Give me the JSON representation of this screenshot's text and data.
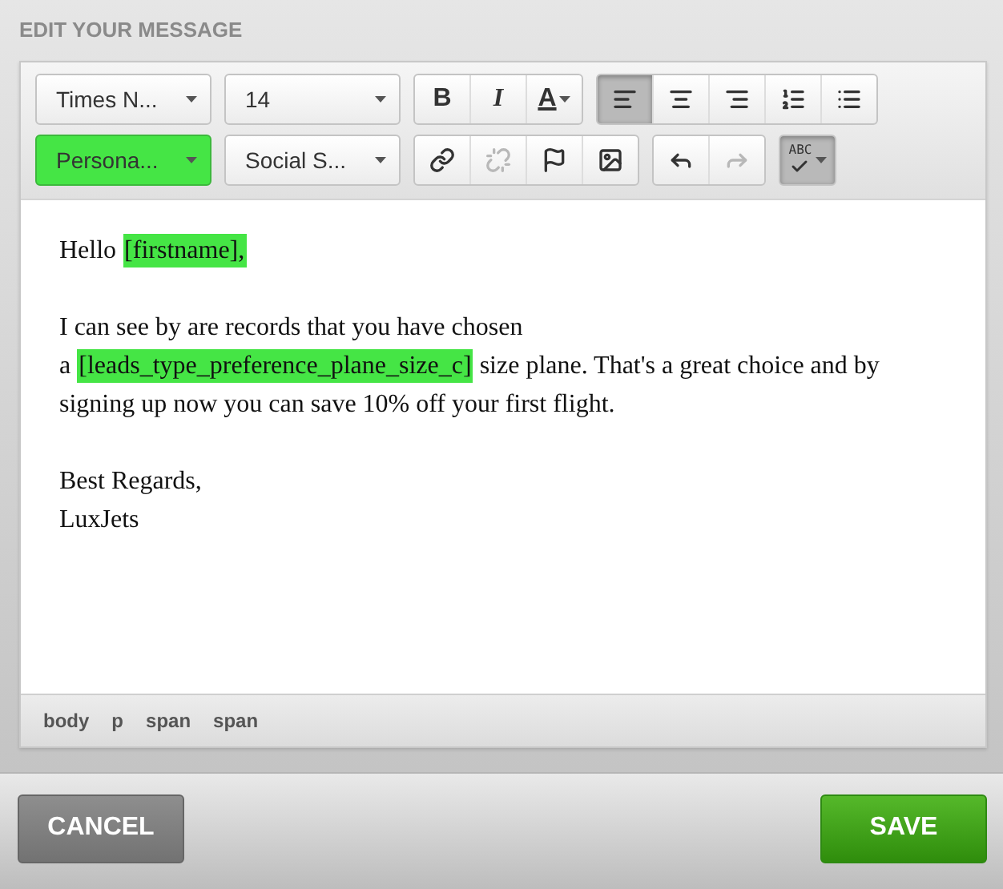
{
  "heading": "EDIT YOUR MESSAGE",
  "toolbar": [
    [
      {
        "kind": "dropdown",
        "label": "Times N...",
        "highlighted": false
      },
      {
        "kind": "dropdown",
        "label": "14",
        "highlighted": false
      },
      {
        "kind": "group",
        "buttons": [
          {
            "kind": "bold",
            "label": "B",
            "selected": false,
            "disabled": false
          },
          {
            "kind": "italic",
            "label": "I",
            "selected": false,
            "disabled": false
          },
          {
            "kind": "color",
            "label": "A",
            "selected": false,
            "disabled": false
          }
        ]
      },
      {
        "kind": "group",
        "buttons": [
          {
            "kind": "alignleft",
            "selected": true,
            "disabled": false
          },
          {
            "kind": "aligncenter",
            "selected": false,
            "disabled": false
          },
          {
            "kind": "alignright",
            "selected": false,
            "disabled": false
          },
          {
            "kind": "numbered",
            "selected": false,
            "disabled": false
          },
          {
            "kind": "bullets",
            "selected": false,
            "disabled": false
          }
        ]
      }
    ],
    [
      {
        "kind": "dropdown",
        "label": "Persona...",
        "highlighted": true
      },
      {
        "kind": "dropdown",
        "label": "Social S...",
        "highlighted": false
      },
      {
        "kind": "group",
        "buttons": [
          {
            "kind": "link",
            "selected": false,
            "disabled": false
          },
          {
            "kind": "unlink",
            "selected": false,
            "disabled": true
          },
          {
            "kind": "flag",
            "selected": false,
            "disabled": false
          },
          {
            "kind": "image",
            "selected": false,
            "disabled": false
          }
        ]
      },
      {
        "kind": "group",
        "buttons": [
          {
            "kind": "undo",
            "selected": false,
            "disabled": false
          },
          {
            "kind": "redo",
            "selected": false,
            "disabled": true
          }
        ]
      },
      {
        "kind": "group",
        "buttons": [
          {
            "kind": "spellcheck",
            "label": "ABC",
            "selected": true,
            "disabled": false
          }
        ]
      }
    ]
  ],
  "content": [
    [
      [
        {
          "text": "Hello ",
          "highlighted": false
        },
        {
          "text": "[firstname],",
          "highlighted": true
        }
      ]
    ],
    [
      [
        {
          "text": "I can see by are records that you have chosen",
          "highlighted": false
        }
      ],
      [
        {
          "text": "a ",
          "highlighted": false
        },
        {
          "text": "[leads_type_preference_plane_size_c]",
          "highlighted": true
        },
        {
          "text": " size plane. That's a great choice and by",
          "highlighted": false
        }
      ],
      [
        {
          "text": "signing up now you can save 10% off your first flight.",
          "highlighted": false
        }
      ]
    ],
    [
      [
        {
          "text": "Best Regards,",
          "highlighted": false
        }
      ],
      [
        {
          "text": "LuxJets",
          "highlighted": false
        }
      ]
    ]
  ],
  "path": [
    "body",
    "p",
    "span",
    "span"
  ],
  "buttons": {
    "cancel": "CANCEL",
    "save": "SAVE"
  }
}
